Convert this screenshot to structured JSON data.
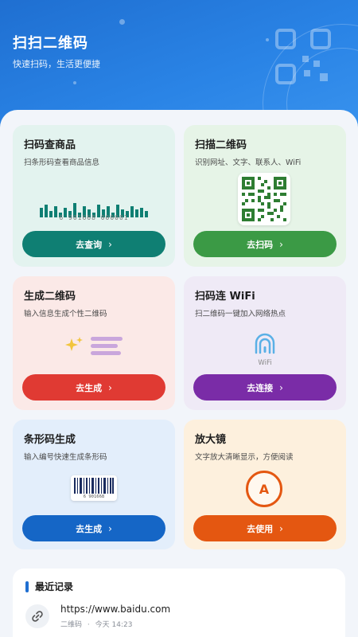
{
  "header": {
    "title": "扫扫二维码",
    "subtitle": "快速扫码，生活更便捷"
  },
  "cards": [
    {
      "title": "扫码查商品",
      "desc": "扫条形码查看商品信息",
      "button": "去查询",
      "art_text": "6 901668 000001",
      "color": "#0f7f73"
    },
    {
      "title": "扫描二维码",
      "desc": "识别网址、文字、联系人、WiFi",
      "button": "去扫码",
      "color": "#3b9a45"
    },
    {
      "title": "生成二维码",
      "desc": "输入信息生成个性二维码",
      "button": "去生成",
      "color": "#e03a33"
    },
    {
      "title": "扫码连 WiFi",
      "desc": "扫二维码一键加入网络热点",
      "button": "去连接",
      "art_text": "WiFi",
      "color": "#7a2ca7"
    },
    {
      "title": "条形码生成",
      "desc": "输入编号快速生成条形码",
      "button": "去生成",
      "art_text": "6 901668",
      "color": "#1566c6"
    },
    {
      "title": "放大镜",
      "desc": "文字放大清晰显示，方便阅读",
      "button": "去使用",
      "art_text": "A",
      "color": "#e45711"
    }
  ],
  "recent": {
    "title": "最近记录",
    "items": [
      {
        "url": "https://www.baidu.com",
        "type": "二维码",
        "time": "今天 14:23",
        "icon": "link-icon"
      }
    ]
  },
  "chevron": "›",
  "separator": "·"
}
